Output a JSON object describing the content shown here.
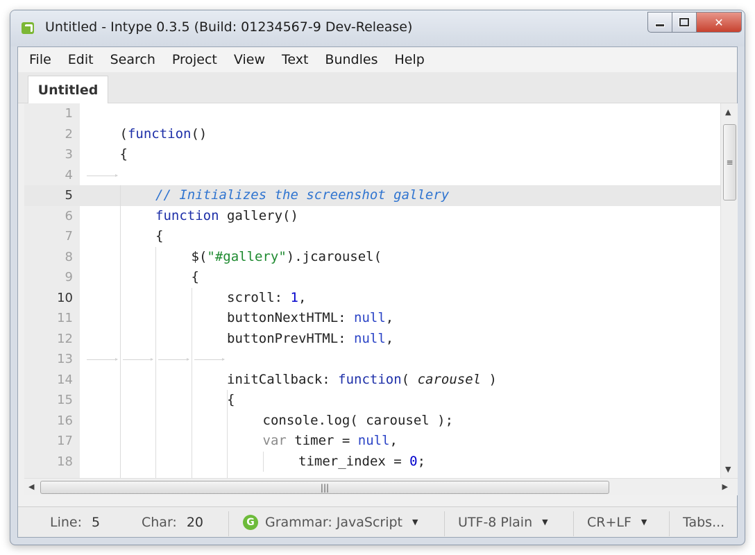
{
  "window": {
    "title": "Untitled - Intype 0.3.5 (Build: 01234567-9 Dev-Release)",
    "minimize_glyph": "–",
    "close_glyph": "✕"
  },
  "menu": [
    "File",
    "Edit",
    "Search",
    "Project",
    "View",
    "Text",
    "Bundles",
    "Help"
  ],
  "tabs": [
    {
      "label": "Untitled",
      "active": true
    }
  ],
  "editor": {
    "current_line": 5,
    "lines": [
      {
        "n": "1",
        "indent": 0,
        "tokens": []
      },
      {
        "n": "2",
        "indent": 1,
        "tokens": [
          {
            "t": "(",
            "c": ""
          },
          {
            "t": "function",
            "c": "kw"
          },
          {
            "t": "()",
            "c": ""
          }
        ]
      },
      {
        "n": "3",
        "indent": 1,
        "tokens": [
          {
            "t": "{",
            "c": ""
          }
        ]
      },
      {
        "n": "4",
        "indent": 0,
        "tokens": []
      },
      {
        "n": "5",
        "indent": 2,
        "tokens": [
          {
            "t": "// Initializes the screenshot gallery",
            "c": "cm"
          }
        ]
      },
      {
        "n": "6",
        "indent": 2,
        "tokens": [
          {
            "t": "function",
            "c": "kw"
          },
          {
            "t": " gallery()",
            "c": ""
          }
        ]
      },
      {
        "n": "7",
        "indent": 2,
        "tokens": [
          {
            "t": "{",
            "c": ""
          }
        ]
      },
      {
        "n": "8",
        "indent": 3,
        "tokens": [
          {
            "t": "$(",
            "c": ""
          },
          {
            "t": "\"#gallery\"",
            "c": "str"
          },
          {
            "t": ").jcarousel(",
            "c": ""
          }
        ]
      },
      {
        "n": "9",
        "indent": 3,
        "tokens": [
          {
            "t": "{",
            "c": ""
          }
        ]
      },
      {
        "n": "10",
        "indent": 4,
        "tokens": [
          {
            "t": "scroll: ",
            "c": ""
          },
          {
            "t": "1",
            "c": "num"
          },
          {
            "t": ",",
            "c": ""
          }
        ]
      },
      {
        "n": "11",
        "indent": 4,
        "tokens": [
          {
            "t": "buttonNextHTML: ",
            "c": ""
          },
          {
            "t": "null",
            "c": "null"
          },
          {
            "t": ",",
            "c": ""
          }
        ]
      },
      {
        "n": "12",
        "indent": 4,
        "tokens": [
          {
            "t": "buttonPrevHTML: ",
            "c": ""
          },
          {
            "t": "null",
            "c": "null"
          },
          {
            "t": ",",
            "c": ""
          }
        ]
      },
      {
        "n": "13",
        "indent": 0,
        "tokens": []
      },
      {
        "n": "14",
        "indent": 4,
        "tokens": [
          {
            "t": "initCallback: ",
            "c": ""
          },
          {
            "t": "function",
            "c": "kw"
          },
          {
            "t": "( ",
            "c": ""
          },
          {
            "t": "carousel",
            "c": "par"
          },
          {
            "t": " )",
            "c": ""
          }
        ]
      },
      {
        "n": "15",
        "indent": 4,
        "tokens": [
          {
            "t": "{",
            "c": ""
          }
        ]
      },
      {
        "n": "16",
        "indent": 5,
        "tokens": [
          {
            "t": "console.log( carousel );",
            "c": ""
          }
        ]
      },
      {
        "n": "17",
        "indent": 5,
        "tokens": [
          {
            "t": "var",
            "c": "var"
          },
          {
            "t": " timer = ",
            "c": ""
          },
          {
            "t": "null",
            "c": "null"
          },
          {
            "t": ",",
            "c": ""
          }
        ]
      },
      {
        "n": "18",
        "indent": 6,
        "tokens": [
          {
            "t": "timer_index = ",
            "c": ""
          },
          {
            "t": "0",
            "c": "num"
          },
          {
            "t": ";",
            "c": ""
          }
        ]
      }
    ]
  },
  "statusbar": {
    "line_label": "Line:",
    "line_value": "5",
    "char_label": "Char:",
    "char_value": "20",
    "grammar_icon_letter": "G",
    "grammar": "Grammar: JavaScript",
    "encoding": "UTF-8 Plain",
    "line_ending": "CR+LF",
    "tabs": "Tabs..."
  },
  "icons": {
    "app": "intype-logo-icon",
    "scroll_up": "▲",
    "scroll_down": "▼",
    "scroll_left": "◀",
    "scroll_right": "▶",
    "dropdown": "▼"
  }
}
